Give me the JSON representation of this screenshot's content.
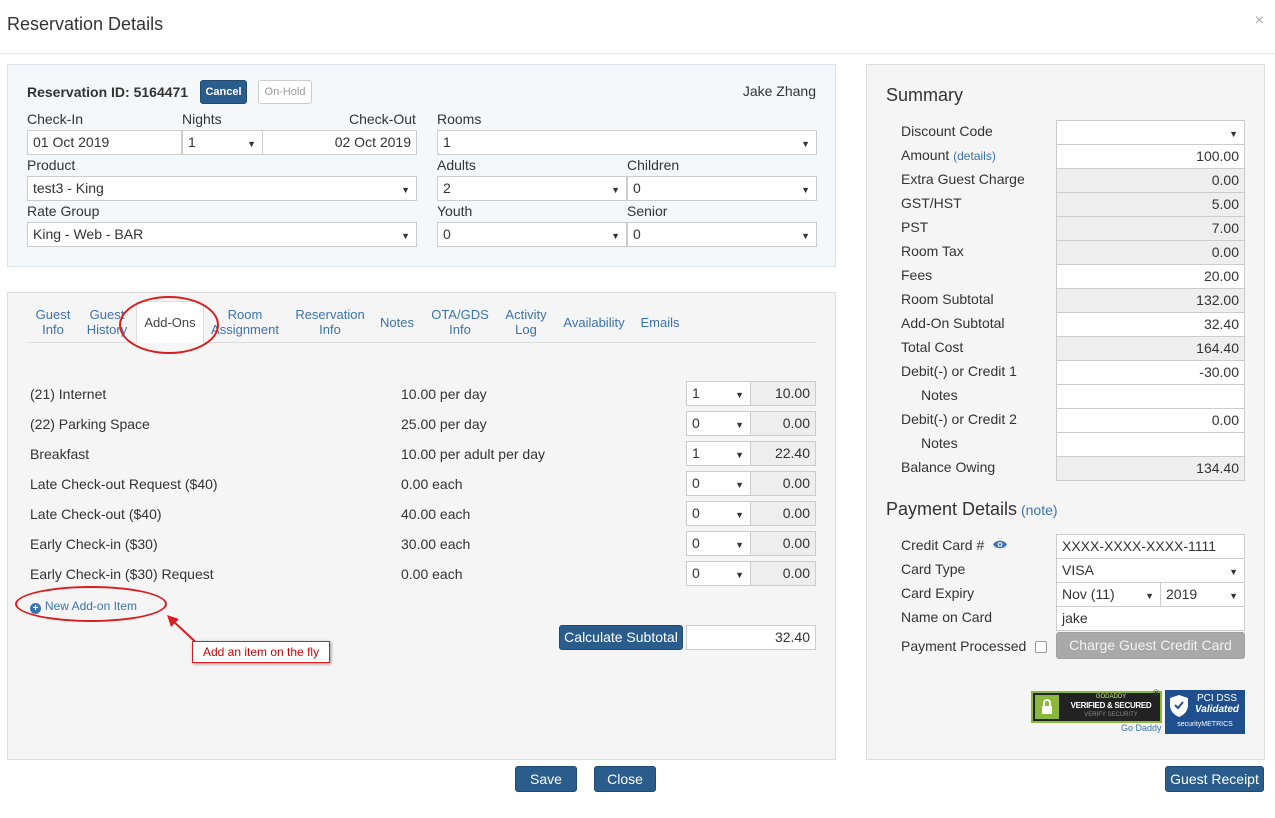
{
  "header": {
    "title": "Reservation Details",
    "close_glyph": "×"
  },
  "reservation": {
    "id_label": "Reservation ID: 5164471",
    "cancel_label": "Cancel",
    "onhold_label": "On-Hold",
    "guest_name": "Jake Zhang",
    "checkin_label": "Check-In",
    "checkin_value": "01 Oct 2019",
    "nights_label": "Nights",
    "nights_value": "1",
    "checkout_label": "Check-Out",
    "checkout_value": "02 Oct 2019",
    "rooms_label": "Rooms",
    "rooms_value": "1",
    "product_label": "Product",
    "product_value": "test3 - King",
    "adults_label": "Adults",
    "adults_value": "2",
    "children_label": "Children",
    "children_value": "0",
    "rategroup_label": "Rate Group",
    "rategroup_value": "King - Web - BAR",
    "youth_label": "Youth",
    "youth_value": "0",
    "senior_label": "Senior",
    "senior_value": "0"
  },
  "tabs": [
    {
      "line1": "Guest",
      "line2": "Info"
    },
    {
      "line1": "Guest",
      "line2": "History"
    },
    {
      "line1": "Add-Ons",
      "line2": ""
    },
    {
      "line1": "Room",
      "line2": "Assignment"
    },
    {
      "line1": "Reservation",
      "line2": "Info"
    },
    {
      "line1": "Notes",
      "line2": ""
    },
    {
      "line1": "OTA/GDS",
      "line2": "Info"
    },
    {
      "line1": "Activity",
      "line2": "Log"
    },
    {
      "line1": "Availability",
      "line2": ""
    },
    {
      "line1": "Emails",
      "line2": ""
    }
  ],
  "addons": {
    "items": [
      {
        "name": "(21) Internet",
        "price": "10.00 per day",
        "qty": "1",
        "total": "10.00"
      },
      {
        "name": "(22) Parking Space",
        "price": "25.00 per day",
        "qty": "0",
        "total": "0.00"
      },
      {
        "name": "Breakfast",
        "price": "10.00 per adult per day",
        "qty": "1",
        "total": "22.40"
      },
      {
        "name": "Late Check-out Request ($40)",
        "price": "0.00 each",
        "qty": "0",
        "total": "0.00"
      },
      {
        "name": "Late Check-out ($40)",
        "price": "40.00 each",
        "qty": "0",
        "total": "0.00"
      },
      {
        "name": "Early Check-in ($30)",
        "price": "30.00 each",
        "qty": "0",
        "total": "0.00"
      },
      {
        "name": "Early Check-in ($30) Request",
        "price": "0.00 each",
        "qty": "0",
        "total": "0.00"
      }
    ],
    "new_item_label": "New Add-on Item",
    "callout_text": "Add an item on the fly",
    "calc_label": "Calculate Subtotal",
    "subtotal_value": "32.40"
  },
  "summary": {
    "title": "Summary",
    "details_link": "(details)",
    "rows": [
      {
        "label": "Discount Code",
        "value": ""
      },
      {
        "label": "Amount",
        "value": "100.00"
      },
      {
        "label": "Extra Guest Charge",
        "value": "0.00"
      },
      {
        "label": "GST/HST",
        "value": "5.00"
      },
      {
        "label": "PST",
        "value": "7.00"
      },
      {
        "label": "Room Tax",
        "value": "0.00"
      },
      {
        "label": "Fees",
        "value": "20.00"
      },
      {
        "label": "Room Subtotal",
        "value": "132.00"
      },
      {
        "label": "Add-On Subtotal",
        "value": "32.40"
      },
      {
        "label": "Total Cost",
        "value": "164.40"
      },
      {
        "label": "Debit(-) or Credit 1",
        "value": "-30.00"
      },
      {
        "label": "Notes",
        "value": ""
      },
      {
        "label": "Debit(-) or Credit 2",
        "value": "0.00"
      },
      {
        "label": "Notes",
        "value": ""
      },
      {
        "label": "Balance Owing",
        "value": "134.40"
      }
    ]
  },
  "payment": {
    "title": "Payment Details",
    "note_link": "(note)",
    "card_label": "Credit Card #",
    "card_value": "XXXX-XXXX-XXXX-1111",
    "type_label": "Card Type",
    "type_value": "VISA",
    "expiry_label": "Card Expiry",
    "expiry_month": "Nov (11)",
    "expiry_year": "2019",
    "name_label": "Name on Card",
    "name_value": "jake",
    "processed_label": "Payment Processed",
    "charge_label": "Charge Guest Credit Card"
  },
  "badges": {
    "godaddy_top": "GODADDY",
    "godaddy_main": "VERIFIED & SECURED",
    "godaddy_sub": "VERIFY SECURITY",
    "godaddy_link": "Go Daddy",
    "pci_line1": "PCI DSS",
    "pci_line2": "Validated",
    "pci_brand": "securityMETRICS"
  },
  "footer": {
    "save_label": "Save",
    "close_label": "Close",
    "receipt_label": "Guest Receipt"
  },
  "colors": {
    "primary": "#2a5d8c",
    "link": "#3b73ae",
    "annotation": "#d81e1e"
  }
}
